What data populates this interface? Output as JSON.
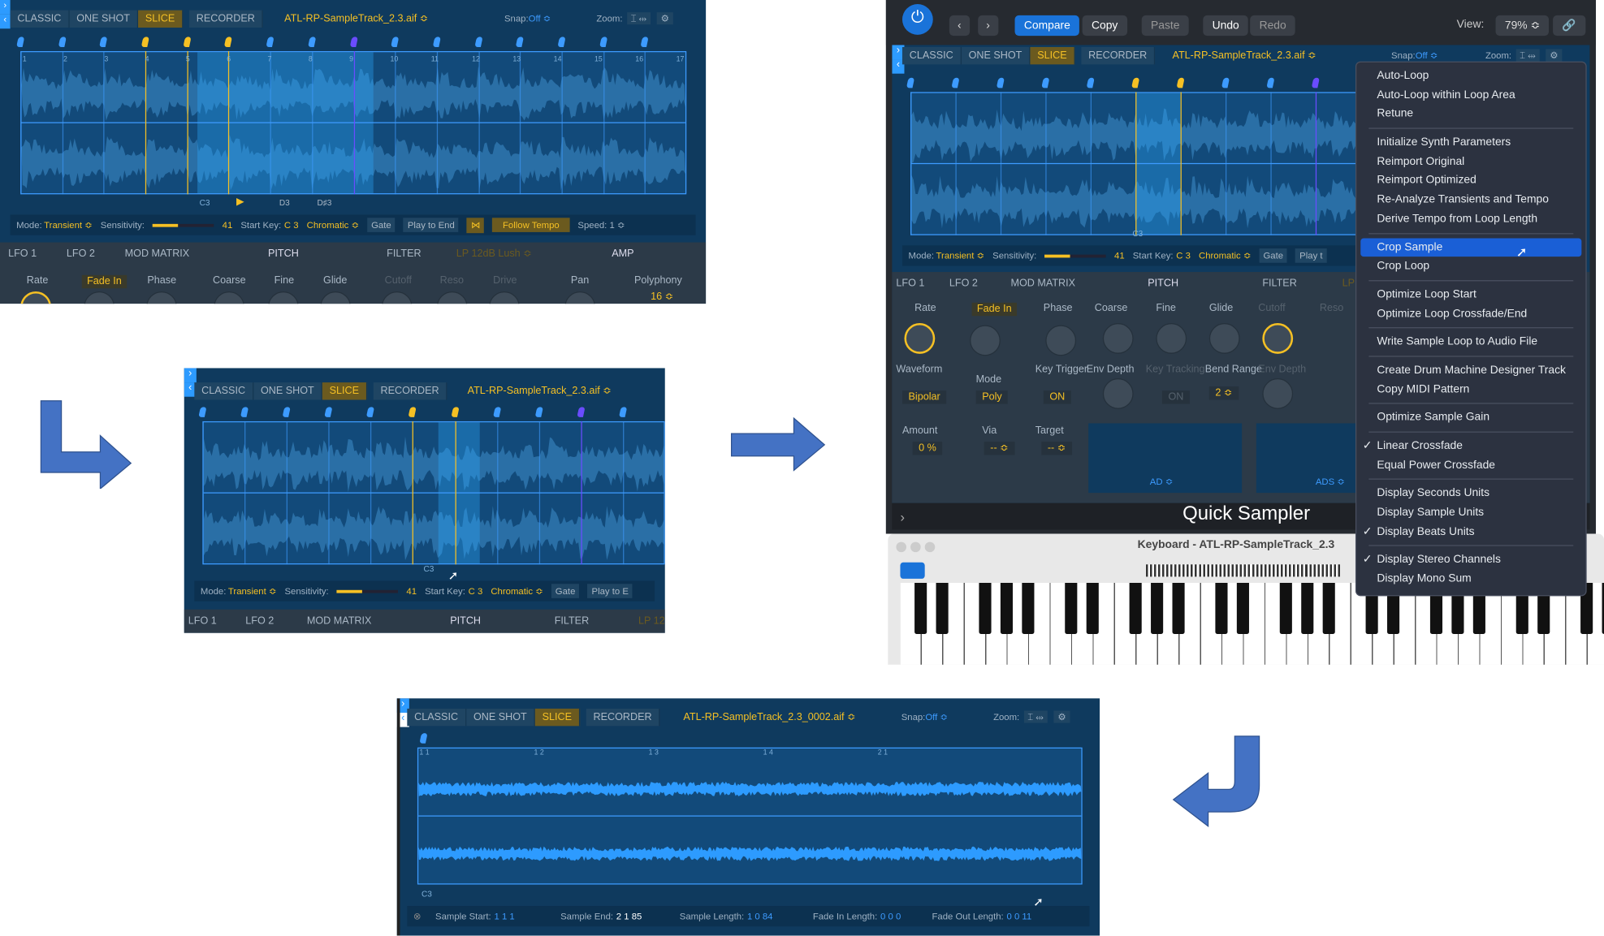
{
  "common": {
    "tabs": [
      "CLASSIC",
      "ONE SHOT",
      "SLICE",
      "RECORDER"
    ],
    "snap_label": "Snap:",
    "snap_value": "Off ≎",
    "zoom_label": "Zoom:"
  },
  "panel_a": {
    "filename": "ATL-RP-SampleTrack_2.3.aif ≎",
    "ruler": [
      "1",
      "2",
      "3",
      "4",
      "5",
      "6",
      "7",
      "8",
      "9",
      "10",
      "11",
      "12",
      "13",
      "14",
      "15",
      "16",
      "17"
    ],
    "notes": [
      "C3",
      "D3",
      "D♯3"
    ],
    "mode_label": "Mode:",
    "mode": "Transient ≎",
    "sens_label": "Sensitivity:",
    "sens_value": "41",
    "sens_fraction": 0.41,
    "start_key_label": "Start Key:",
    "start_key": "C 3",
    "chromatic": "Chromatic ≎",
    "gate": "Gate",
    "play_to_end": "Play to End",
    "follow_tempo": "Follow Tempo",
    "speed": "Speed: 1 ≎",
    "sections": [
      "LFO 1",
      "LFO 2",
      "MOD MATRIX",
      "PITCH",
      "FILTER",
      "LP 12dB Lush ≎",
      "AMP"
    ],
    "params": [
      "Rate",
      "Fade In",
      "Phase",
      "Coarse",
      "Fine",
      "Glide",
      "Cutoff",
      "Reso",
      "Drive",
      "Pan",
      "Polyphony"
    ],
    "polyphony": "16 ≎"
  },
  "panel_b": {
    "filename": "ATL-RP-SampleTrack_2.3.aif ≎",
    "notes": [
      "C3"
    ],
    "mode_label": "Mode:",
    "mode": "Transient ≎",
    "sens_label": "Sensitivity:",
    "sens_value": "41",
    "start_key_label": "Start Key:",
    "start_key": "C 3",
    "chromatic": "Chromatic ≎",
    "gate": "Gate",
    "play_to_end": "Play to E",
    "sections": [
      "LFO 1",
      "LFO 2",
      "MOD MATRIX",
      "PITCH",
      "FILTER",
      "LP 12"
    ]
  },
  "panel_c": {
    "toolbar": {
      "compare": "Compare",
      "copy": "Copy",
      "paste": "Paste",
      "undo": "Undo",
      "redo": "Redo",
      "view_label": "View:",
      "view_value": "79% ≎"
    },
    "filename": "ATL-RP-SampleTrack_2.3.aif ≎",
    "notes": [
      "C3"
    ],
    "mode_label": "Mode:",
    "mode": "Transient ≎",
    "sens_label": "Sensitivity:",
    "sens_value": "41",
    "start_key_label": "Start Key:",
    "start_key": "C 3",
    "chromatic": "Chromatic ≎",
    "gate": "Gate",
    "play_to_end": "Play t",
    "sections": [
      "LFO 1",
      "LFO 2",
      "MOD MATRIX",
      "PITCH",
      "FILTER",
      "LP"
    ],
    "params": [
      "Rate",
      "Fade In",
      "Phase",
      "Coarse",
      "Fine",
      "Glide",
      "Cutoff",
      "Reso",
      "Waveform",
      "Mode",
      "Key Trigger",
      "Env Depth",
      "Key Tracking",
      "Bend Range",
      "Env Depth",
      "Amount",
      "Via",
      "Target"
    ],
    "values": {
      "waveform": "Bipolar",
      "mode": "Poly",
      "key_trigger": "ON",
      "key_tracking": "ON",
      "bend_range": "2 ≎",
      "amount": "0 %",
      "via": "-- ≎",
      "target": "-- ≎",
      "env1": "AD ≎",
      "env2": "ADS ≎"
    },
    "footer_title": "Quick Sampler",
    "keyboard_title": "Keyboard - ATL-RP-SampleTrack_2.3",
    "menu": [
      [
        "Auto-Loop",
        "Auto-Loop within Loop Area",
        "Retune"
      ],
      [
        "Initialize Synth Parameters",
        "Reimport Original",
        "Reimport Optimized",
        "Re-Analyze Transients and Tempo",
        "Derive Tempo from Loop Length"
      ],
      [
        "Crop Sample",
        "Crop Loop"
      ],
      [
        "Optimize Loop Start",
        "Optimize Loop Crossfade/End"
      ],
      [
        "Write Sample Loop to Audio File"
      ],
      [
        "Create Drum Machine Designer Track",
        "Copy MIDI Pattern"
      ],
      [
        "Optimize Sample Gain"
      ],
      [
        "Linear Crossfade",
        "Equal Power Crossfade"
      ],
      [
        "Display Seconds Units",
        "Display Sample Units",
        "Display Beats Units"
      ],
      [
        "Display Stereo Channels",
        "Display Mono Sum"
      ]
    ],
    "menu_selected": "Crop Sample",
    "menu_checked": [
      "Linear Crossfade",
      "Display Beats Units",
      "Display Stereo Channels"
    ]
  },
  "panel_d": {
    "filename": "ATL-RP-SampleTrack_2.3_0002.aif ≎",
    "ruler": [
      "1 1",
      "1 2",
      "1 3",
      "1 4",
      "2 1"
    ],
    "note": "C3",
    "status": [
      {
        "label": "Sample Start:",
        "value": "1 1 1"
      },
      {
        "label": "Sample End:",
        "value": "2 1 85"
      },
      {
        "label": "Sample Length:",
        "value": "1 0 84"
      },
      {
        "label": "Fade In Length:",
        "value": "0 0 0"
      },
      {
        "label": "Fade Out Length:",
        "value": "0 0 11"
      }
    ]
  },
  "colors": {
    "panel": "#0f3a5e",
    "accent_yellow": "#f5c024",
    "accent_blue": "#3d9bff",
    "arrow": "#4472c4",
    "menu_highlight": "#1a5fd6"
  }
}
